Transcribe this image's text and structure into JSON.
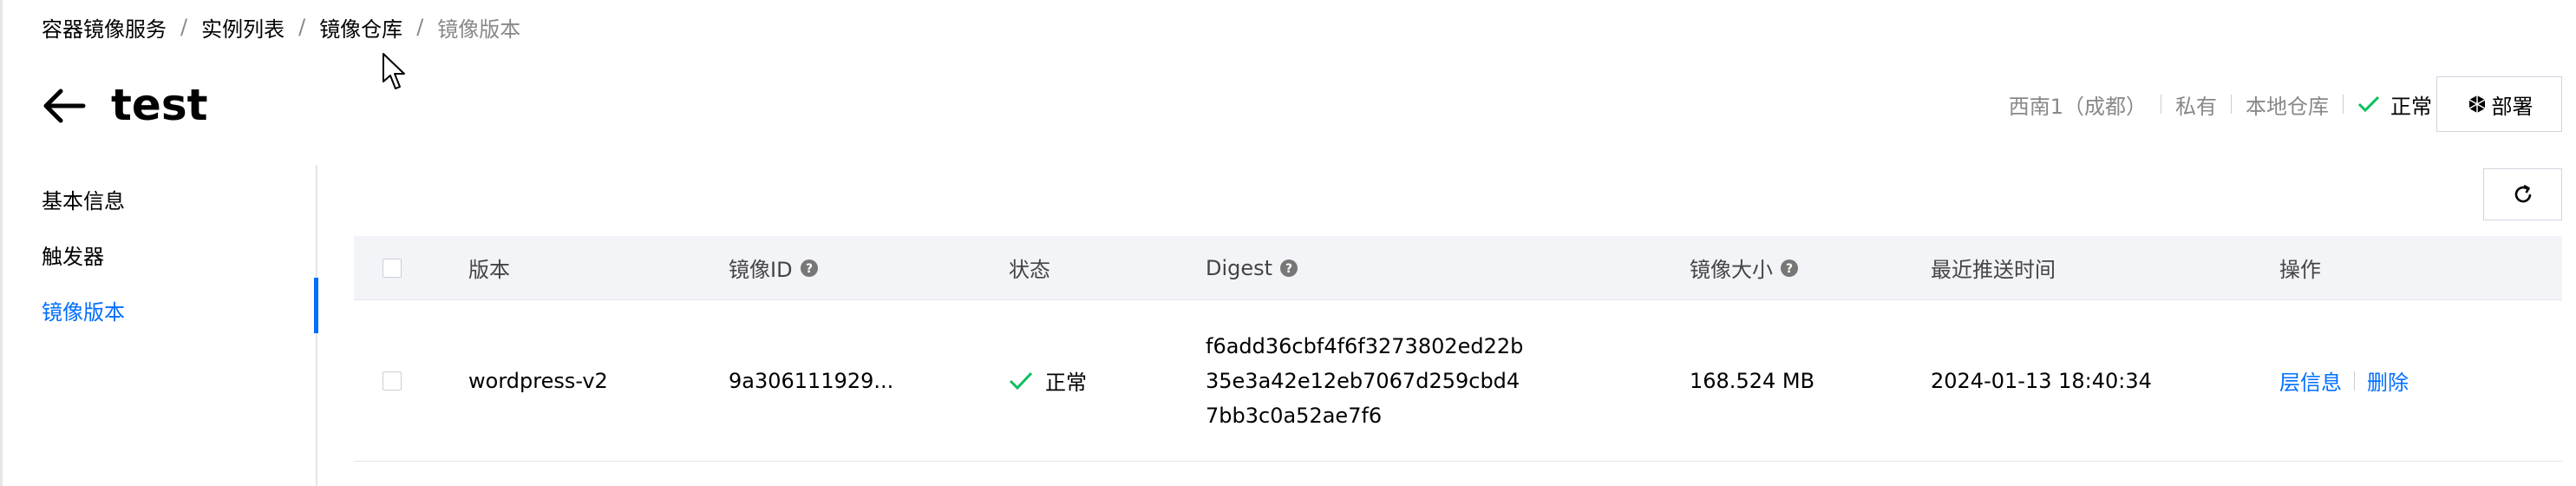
{
  "breadcrumb": {
    "items": [
      "容器镜像服务",
      "实例列表",
      "镜像仓库"
    ],
    "current": "镜像版本",
    "separator": "/"
  },
  "header": {
    "title": "test",
    "region": "西南1（成都）",
    "visibility": "私有",
    "repo_type": "本地仓库",
    "status": "正常",
    "deploy_label": "部署"
  },
  "sidebar": {
    "items": [
      {
        "label": "基本信息"
      },
      {
        "label": "触发器"
      },
      {
        "label": "镜像版本"
      }
    ],
    "active_index": 2
  },
  "table": {
    "columns": {
      "version": "版本",
      "image_id": "镜像ID",
      "status": "状态",
      "digest": "Digest",
      "size": "镜像大小",
      "pushed_at": "最近推送时间",
      "actions": "操作"
    },
    "rows": [
      {
        "version": "wordpress-v2",
        "image_id": "9a306111929...",
        "status": "正常",
        "digest_lines": [
          "f6add36cbf4f6f3273802ed22b",
          "35e3a42e12eb7067d259cbd4",
          "7bb3c0a52ae7f6"
        ],
        "size": "168.524 MB",
        "pushed_at": "2024-01-13 18:40:34",
        "action_layers": "层信息",
        "action_delete": "删除"
      }
    ]
  },
  "colors": {
    "accent": "#006eff",
    "success": "#0abf5b",
    "header_bg": "#f3f4f7",
    "muted": "#888888"
  },
  "icons": {
    "back": "arrow-left-icon",
    "status_ok": "check-icon",
    "deploy": "cube-icon",
    "refresh": "refresh-icon",
    "help": "help-circle-icon"
  }
}
